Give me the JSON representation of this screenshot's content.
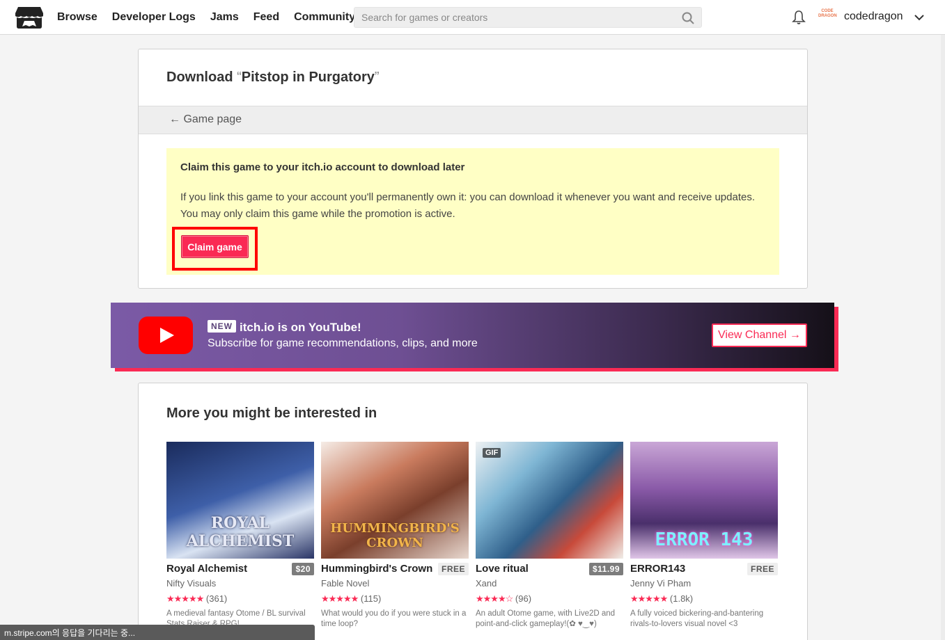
{
  "header": {
    "nav": [
      "Browse",
      "Developer Logs",
      "Jams",
      "Feed",
      "Community"
    ],
    "search_placeholder": "Search for games or creators",
    "avatar_text": "CODE DRAGON",
    "username": "codedragon"
  },
  "download": {
    "title_prefix": "Download ",
    "open_quote": "“",
    "game_name": "Pitstop in Purgatory",
    "close_quote": "”",
    "back_label": "← Game page",
    "claim_heading": "Claim this game to your itch.io account to download later",
    "claim_text": "If you link this game to your account you'll permanently own it: you can download it whenever you want and receive updates. You may only claim this game while the promotion is active.",
    "claim_button": "Claim game"
  },
  "banner": {
    "badge": "NEW",
    "title": "itch.io is on YouTube!",
    "subtitle": "Subscribe for game recommendations, clips, and more",
    "button": "View Channel →"
  },
  "recommendations": {
    "title": "More you might be interested in",
    "games": [
      {
        "title": "Royal Alchemist",
        "price": "$20",
        "author": "Nifty Visuals",
        "stars": "★★★★★",
        "count": "(361)",
        "desc": "A medieval fantasy Otome / BL survival Stats Raiser & RPG!",
        "thumb_text": "ROYAL ALCHEMIST",
        "gif": ""
      },
      {
        "title": "Hummingbird's Crown",
        "price": "FREE",
        "author": "Fable Novel",
        "stars": "★★★★★",
        "count": "(115)",
        "desc": "What would you do if you were stuck in a time loop?",
        "thumb_text": "HUMMINGBIRD'S CROWN",
        "gif": ""
      },
      {
        "title": "Love ritual",
        "price": "$11.99",
        "author": "Xand",
        "stars": "★★★★☆",
        "count": "(96)",
        "desc": "An adult Otome game, with Live2D and point-and-click gameplay!(✿ ♥‿♥)",
        "thumb_text": "",
        "gif": "GIF"
      },
      {
        "title": "ERROR143",
        "price": "FREE",
        "author": "Jenny Vi Pham",
        "stars": "★★★★★",
        "count": "(1.8k)",
        "desc": "A fully voiced bickering-and-bantering rivals-to-lovers visual novel <3",
        "thumb_text": "ERROR 143",
        "gif": ""
      }
    ]
  },
  "status": "m.stripe.com의 응답을 기다리는 중...",
  "colors": {
    "accent": "#fa2a54",
    "highlight": "#ffffc5",
    "annotation": "#ff0000"
  }
}
